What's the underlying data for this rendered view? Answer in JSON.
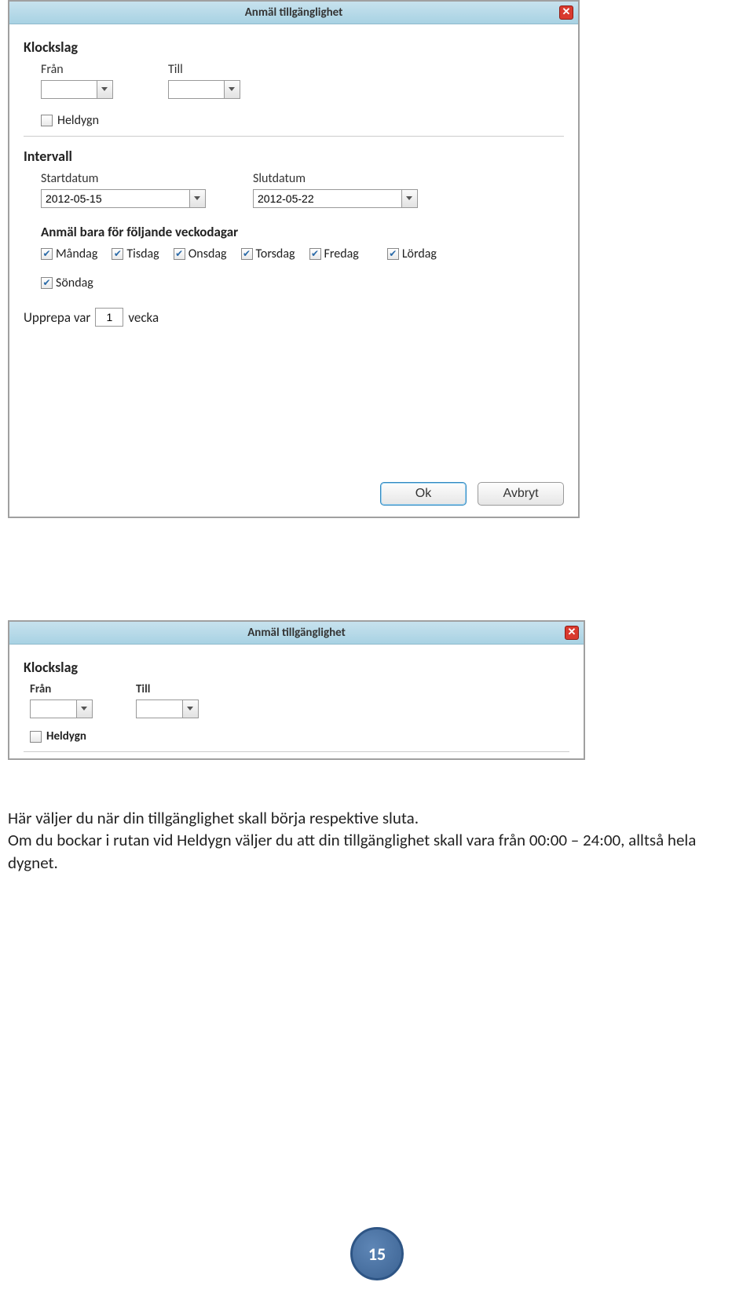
{
  "dialog1": {
    "title": "Anmäl tillgänglighet",
    "klockslag_heading": "Klockslag",
    "from_label": "Från",
    "till_label": "Till",
    "from_value": "",
    "till_value": "",
    "heldygn_label": "Heldygn",
    "heldygn_checked": false,
    "intervall_heading": "Intervall",
    "start_label": "Startdatum",
    "slut_label": "Slutdatum",
    "start_value": "2012-05-15",
    "slut_value": "2012-05-22",
    "weekdays_heading": "Anmäl bara för följande veckodagar",
    "days": [
      {
        "label": "Måndag",
        "checked": true
      },
      {
        "label": "Tisdag",
        "checked": true
      },
      {
        "label": "Onsdag",
        "checked": true
      },
      {
        "label": "Torsdag",
        "checked": true
      },
      {
        "label": "Fredag",
        "checked": true
      },
      {
        "label": "Lördag",
        "checked": true
      },
      {
        "label": "Söndag",
        "checked": true
      }
    ],
    "repeat_prefix": "Upprepa var",
    "repeat_value": "1",
    "repeat_suffix": "vecka",
    "ok_label": "Ok",
    "cancel_label": "Avbryt"
  },
  "dialog2": {
    "title": "Anmäl tillgänglighet",
    "klockslag_heading": "Klockslag",
    "from_label": "Från",
    "till_label": "Till",
    "from_value": "",
    "till_value": "",
    "heldygn_label": "Heldygn",
    "heldygn_checked": false
  },
  "paragraph": {
    "line1": "Här väljer du när din tillgänglighet skall börja respektive sluta.",
    "line2": "Om du bockar i rutan vid Heldygn väljer du att din tillgänglighet skall vara från 00:00 – 24:00, alltså hela dygnet."
  },
  "page_number": "15",
  "check_glyph": "✔",
  "close_glyph": "✕"
}
